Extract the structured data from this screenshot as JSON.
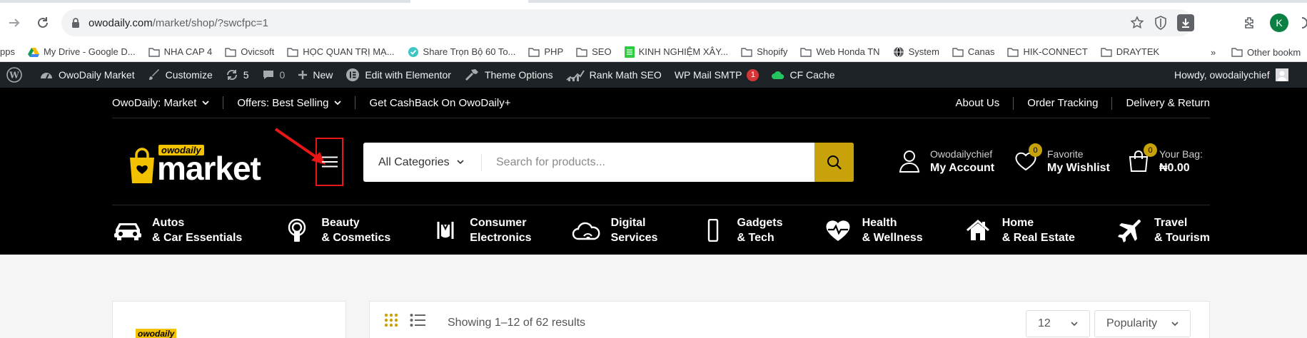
{
  "browser": {
    "url_host": "owodaily.com",
    "url_path": "/market/shop/?swcfpc=1",
    "profile_initial": "K"
  },
  "bookmarks": {
    "items": [
      {
        "label": "pps",
        "icon": "none"
      },
      {
        "label": "My Drive - Google D...",
        "icon": "drive-icon"
      },
      {
        "label": "NHA CAP 4",
        "icon": "folder-icon"
      },
      {
        "label": "Ovicsoft",
        "icon": "folder-icon"
      },
      {
        "label": "HỌC QUAN TRỊ MẠ...",
        "icon": "folder-icon"
      },
      {
        "label": "Share Trọn Bộ 60 To...",
        "icon": "check-circle-icon"
      },
      {
        "label": "PHP",
        "icon": "folder-icon"
      },
      {
        "label": "SEO",
        "icon": "folder-icon"
      },
      {
        "label": "KINH NGHIỆM XÂY...",
        "icon": "sheet-icon"
      },
      {
        "label": "Shopify",
        "icon": "folder-icon"
      },
      {
        "label": "Web Honda TN",
        "icon": "folder-icon"
      },
      {
        "label": "System",
        "icon": "globe-icon"
      },
      {
        "label": "Canas",
        "icon": "folder-icon"
      },
      {
        "label": "HIK-CONNECT",
        "icon": "folder-icon"
      },
      {
        "label": "DRAYTEK",
        "icon": "folder-icon"
      }
    ],
    "more": "»",
    "other": "Other bookm"
  },
  "adminbar": {
    "site_name": "OwoDaily Market",
    "customize": "Customize",
    "updates": "5",
    "comments": "0",
    "new": "New",
    "elementor": "Edit with Elementor",
    "theme_options": "Theme Options",
    "rank_math": "Rank Math SEO",
    "wp_mail": "WP Mail SMTP",
    "wp_mail_badge": "1",
    "cf_cache": "CF Cache",
    "howdy": "Howdy, owodailychief"
  },
  "topbar": {
    "market": "OwoDaily: Market",
    "offers": "Offers: Best Selling",
    "cashback": "Get CashBack On OwoDaily+",
    "about": "About Us",
    "tracking": "Order Tracking",
    "delivery": "Delivery & Return"
  },
  "logo": {
    "small": "owodaily",
    "big": "market"
  },
  "search": {
    "category": "All Categories",
    "placeholder": "Search for products..."
  },
  "account": {
    "line1": "Owodailychief",
    "line2": "My Account"
  },
  "wishlist": {
    "line1": "Favorite",
    "line2": "My Wishlist",
    "count": "0"
  },
  "bag": {
    "line1": "Your Bag:",
    "line2": "₦0.00",
    "count": "0"
  },
  "categories": [
    {
      "l1": "Autos",
      "l2": "& Car Essentials",
      "icon": "car-icon"
    },
    {
      "l1": "Beauty",
      "l2": "& Cosmetics",
      "icon": "beauty-icon"
    },
    {
      "l1": "Consumer",
      "l2": "Electronics",
      "icon": "electronics-icon"
    },
    {
      "l1": "Digital",
      "l2": "Services",
      "icon": "cloud-icon"
    },
    {
      "l1": "Gadgets",
      "l2": "& Tech",
      "icon": "phone-icon"
    },
    {
      "l1": "Health",
      "l2": "& Wellness",
      "icon": "heartbeat-icon"
    },
    {
      "l1": "Home",
      "l2": "& Real Estate",
      "icon": "house-icon"
    },
    {
      "l1": "Travel",
      "l2": "& Tourism",
      "icon": "plane-icon"
    }
  ],
  "shop": {
    "results": "Showing 1–12 of 62 results",
    "per_page": "12",
    "sort": "Popularity"
  },
  "colors": {
    "accent": "#c7a20a",
    "highlight": "#e81717",
    "header_bg": "#000000",
    "adminbar_bg": "#1d2327"
  }
}
